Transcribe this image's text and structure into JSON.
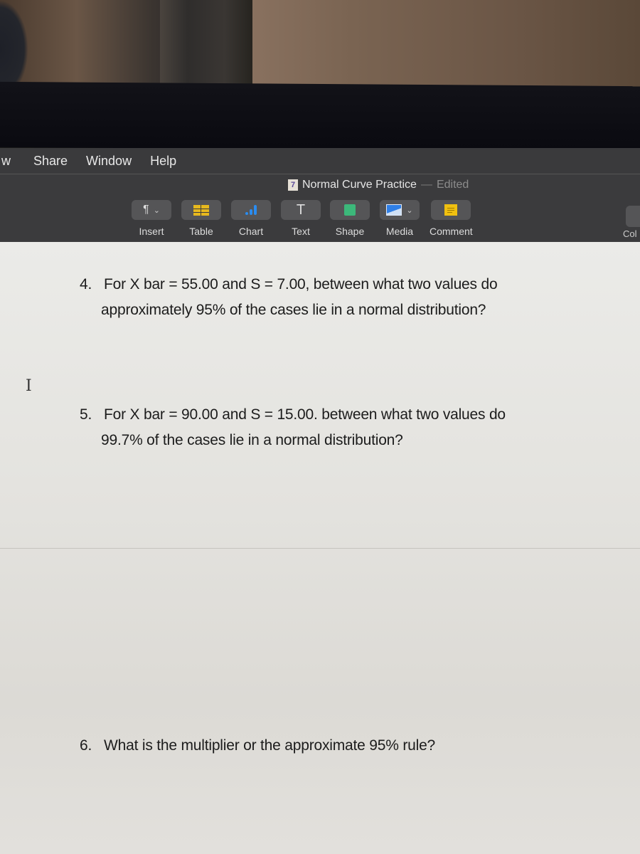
{
  "menubar": {
    "items": [
      "w",
      "Share",
      "Window",
      "Help"
    ]
  },
  "window": {
    "title": "Normal Curve Practice",
    "separator": "—",
    "status": "Edited",
    "doc_icon_glyph": "7"
  },
  "toolbar": {
    "tools": [
      {
        "label": "Insert",
        "icon": "paragraph-icon",
        "glyph": "¶",
        "has_dropdown": true
      },
      {
        "label": "Table",
        "icon": "table-icon"
      },
      {
        "label": "Chart",
        "icon": "chart-icon"
      },
      {
        "label": "Text",
        "icon": "text-icon",
        "glyph": "T"
      },
      {
        "label": "Shape",
        "icon": "shape-icon"
      },
      {
        "label": "Media",
        "icon": "media-icon",
        "has_dropdown": true
      },
      {
        "label": "Comment",
        "icon": "comment-icon"
      }
    ],
    "partial_label": "Col",
    "chevron_glyph": "⌄",
    "colors": {
      "table": "#e6b81e",
      "chart": "#2a8cf0",
      "shape": "#3cb87a",
      "media": "#2f7fe6",
      "comment": "#f0c010"
    }
  },
  "document": {
    "questions": [
      {
        "number": "4.",
        "line1": "For X bar = 55.00 and S = 7.00, between what two values do",
        "line2": "approximately 95% of the cases lie in a normal distribution?"
      },
      {
        "number": "5.",
        "line1": "For X bar = 90.00 and S = 15.00. between what two values do",
        "line2": "99.7% of the cases lie in a normal distribution?"
      },
      {
        "number": "6.",
        "line1": "What is the multiplier or the approximate 95% rule?"
      }
    ],
    "text_cursor_glyph": "I"
  }
}
